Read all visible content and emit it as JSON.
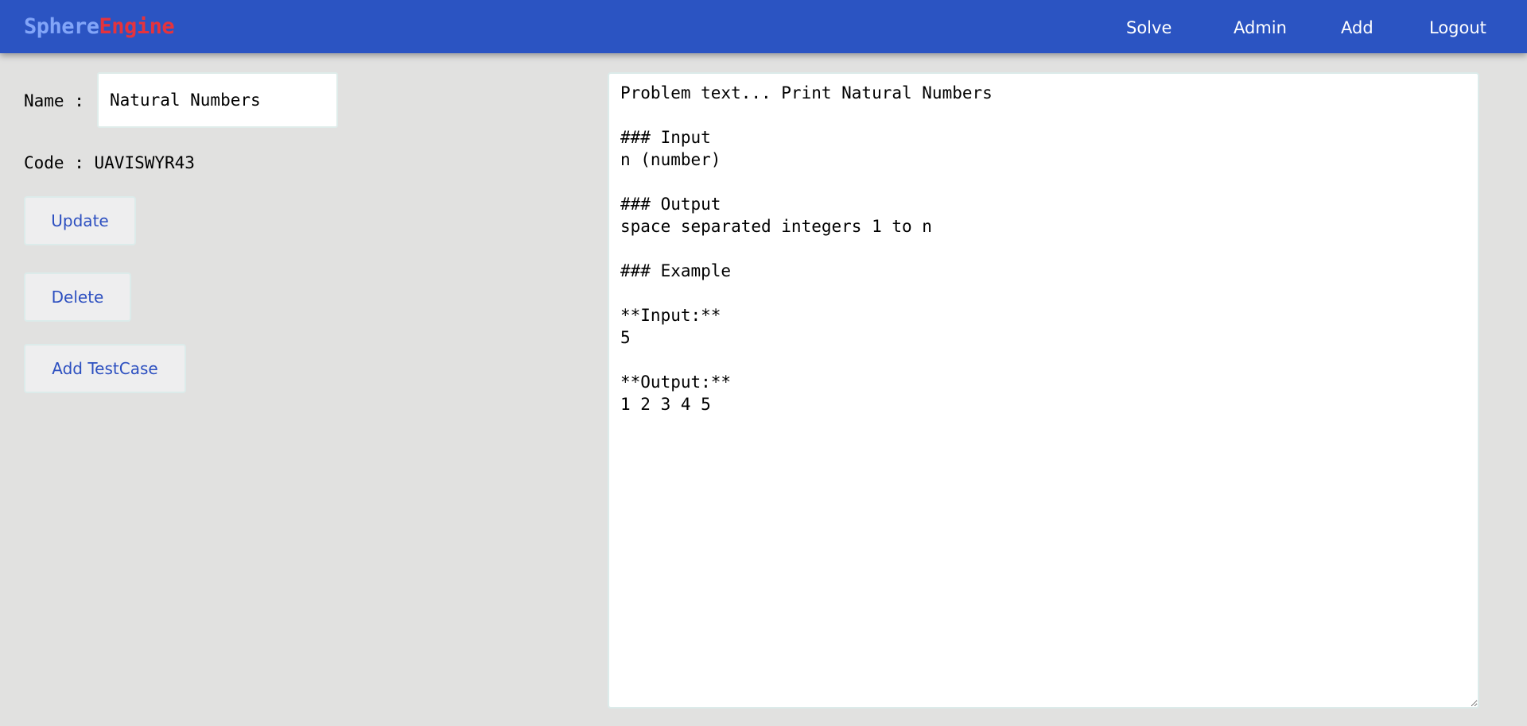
{
  "brand": {
    "part1": "Sphere",
    "part2": "Engine"
  },
  "nav": {
    "solve": "Solve",
    "admin": "Admin",
    "add": "Add",
    "logout": "Logout"
  },
  "form": {
    "name_label": "Name :",
    "name_value": "Natural Numbers",
    "code_label": "Code : ",
    "code_value": "UAVISWYR43"
  },
  "buttons": {
    "update": "Update",
    "delete": "Delete",
    "add_testcase": "Add TestCase"
  },
  "problem_text": "Problem text... Print Natural Numbers\n\n### Input\nn (number)\n\n### Output\nspace separated integers 1 to n\n\n### Example\n\n**Input:**\n5\n\n**Output:**\n1 2 3 4 5",
  "colors": {
    "navbar": "#2b54c2",
    "brand_sphere": "#82a5f8",
    "brand_engine": "#e5333d",
    "button_text": "#2c4fc0",
    "page_background": "#e1e1e0"
  }
}
